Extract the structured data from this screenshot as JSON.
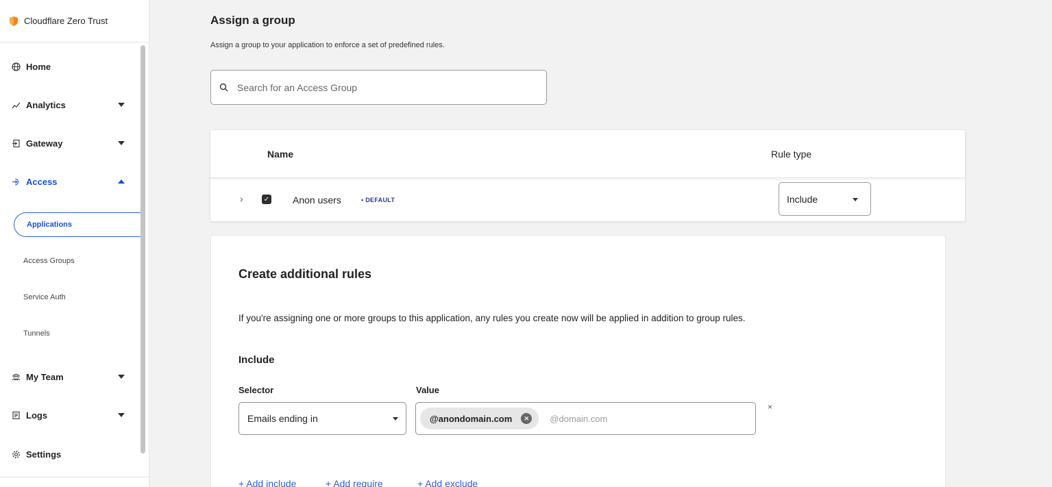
{
  "brand": {
    "name": "Cloudflare Zero Trust",
    "logo_icon": "cloudflare-shield-icon",
    "logo_color": "#f6821f"
  },
  "sidebar": {
    "items": [
      {
        "label": "Home",
        "icon": "globe-icon"
      },
      {
        "label": "Analytics",
        "icon": "analytics-icon",
        "expandable": true
      },
      {
        "label": "Gateway",
        "icon": "gateway-icon",
        "expandable": true
      },
      {
        "label": "Access",
        "icon": "access-icon",
        "expandable": true,
        "expanded": true,
        "active": true
      },
      {
        "label": "My Team",
        "icon": "team-icon",
        "expandable": true
      },
      {
        "label": "Logs",
        "icon": "logs-icon",
        "expandable": true
      },
      {
        "label": "Settings",
        "icon": "gear-icon"
      }
    ],
    "access_sub": [
      "Applications",
      "Access Groups",
      "Service Auth",
      "Tunnels"
    ],
    "access_sub_active": "Applications",
    "accent_color": "#1a4fd1"
  },
  "assign": {
    "title": "Assign a group",
    "description": "Assign a group to your application to enforce a set of predefined rules.",
    "search_placeholder": "Search for an Access Group"
  },
  "groups_table": {
    "columns": [
      "Name",
      "Rule type"
    ],
    "rows": [
      {
        "name": "Anon users",
        "badge": "• DEFAULT",
        "checked": true,
        "rule_type": "Include"
      }
    ]
  },
  "additional_rules": {
    "title": "Create additional rules",
    "description": "If you're assigning one or more groups to this application, any rules you create now will be applied in addition to group rules.",
    "include_label": "Include",
    "selector_label": "Selector",
    "value_label": "Value",
    "selector_value": "Emails ending in",
    "chip_value": "@anondomain.com",
    "value_placeholder": "@domain.com",
    "remove_symbol": "×",
    "links": [
      "+ Add include",
      "+ Add require",
      "+ Add exclude"
    ]
  }
}
